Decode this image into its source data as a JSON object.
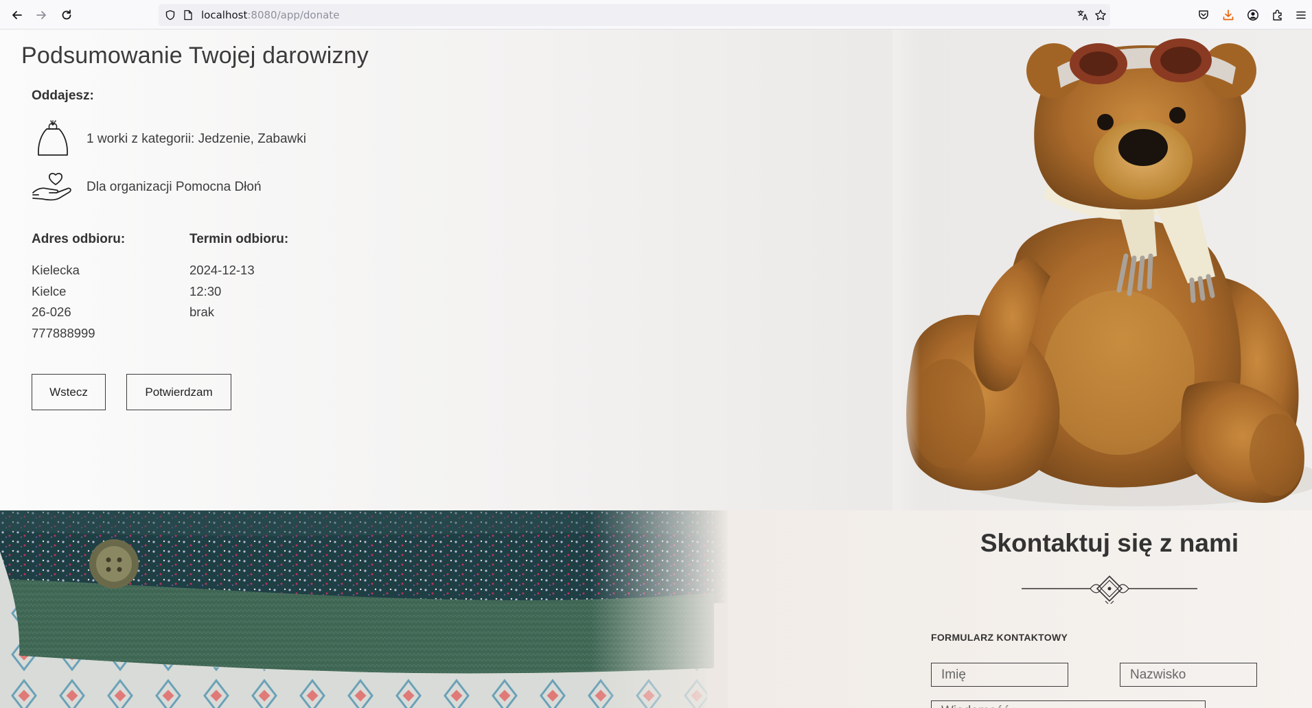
{
  "browser": {
    "url_host": "localhost",
    "url_rest": ":8080/app/donate",
    "icons": [
      "back-icon",
      "forward-icon",
      "reload-icon",
      "shield-icon",
      "page-icon",
      "translate-icon",
      "star-icon",
      "pocket-icon",
      "download-icon",
      "account-icon",
      "extensions-icon",
      "menu-icon"
    ],
    "download_color": "#e8630a"
  },
  "summary": {
    "title": "Podsumowanie Twojej darowizny",
    "give_label": "Oddajesz:",
    "bags_text": "1 worki z kategorii: Jedzenie, Zabawki",
    "institution_text": "Dla organizacji Pomocna Dłoń",
    "address": {
      "title": "Adres odbioru:",
      "lines": [
        "Kielecka",
        "Kielce",
        "26-026",
        "777888999"
      ]
    },
    "pickup": {
      "title": "Termin odbioru:",
      "lines": [
        "2024-12-13",
        "12:30",
        "brak"
      ]
    },
    "buttons": {
      "back": "Wstecz",
      "confirm": "Potwierdzam"
    }
  },
  "contact": {
    "title": "Skontaktuj się z nami",
    "form_label": "FORMULARZ KONTAKTOWY",
    "name_placeholder": "Imię",
    "surname_placeholder": "Nazwisko",
    "message_placeholder": "Wiadomość"
  }
}
